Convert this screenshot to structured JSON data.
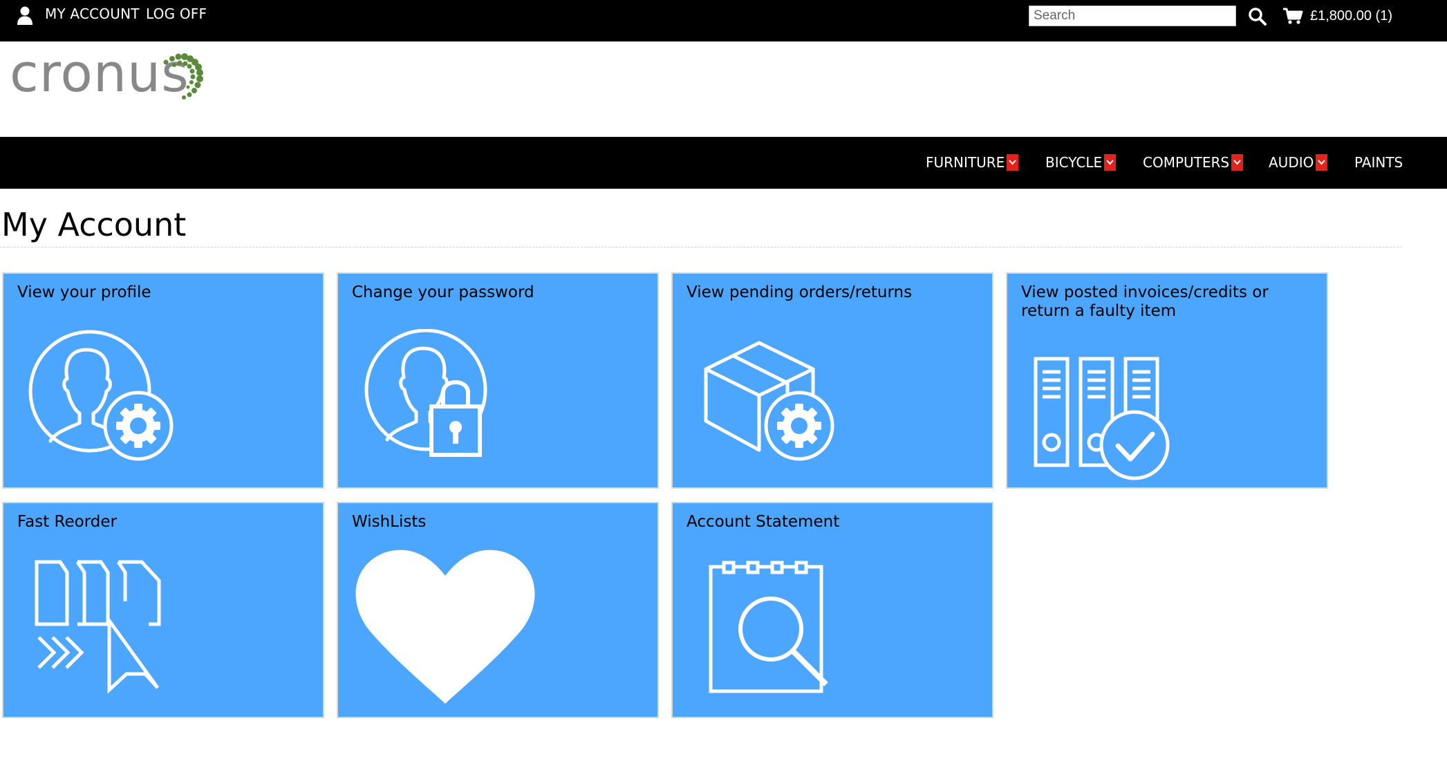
{
  "header": {
    "my_account": "MY ACCOUNT",
    "log_off": "LOG OFF",
    "search_placeholder": "Search",
    "cart_summary": "£1,800.00 (1)",
    "icons": [
      "user-icon",
      "search-icon",
      "cart-icon"
    ]
  },
  "logo": {
    "text": "cronus"
  },
  "nav": {
    "items": [
      {
        "label": "FURNITURE",
        "dropdown": true
      },
      {
        "label": "BICYCLE",
        "dropdown": true
      },
      {
        "label": "COMPUTERS",
        "dropdown": true
      },
      {
        "label": "AUDIO",
        "dropdown": true
      },
      {
        "label": "PAINTS",
        "dropdown": false
      }
    ]
  },
  "page": {
    "title": "My Account"
  },
  "tiles": [
    {
      "label": "View your profile",
      "icon": "profile-settings-icon"
    },
    {
      "label": "Change your password",
      "icon": "profile-lock-icon"
    },
    {
      "label": "View pending orders/returns",
      "icon": "box-settings-icon"
    },
    {
      "label": "View posted invoices/credits or return a faulty item",
      "icon": "binders-check-icon"
    },
    {
      "label": "Fast Reorder",
      "icon": "reorder-icon"
    },
    {
      "label": "WishLists",
      "icon": "heart-icon"
    },
    {
      "label": "Account Statement",
      "icon": "statement-search-icon"
    }
  ],
  "colors": {
    "bar_background": "#000000",
    "tile_background": "#4da6fd",
    "nav_caret": "#e0231c",
    "logo_text": "#888888",
    "logo_dots": "#5a8a3a"
  }
}
